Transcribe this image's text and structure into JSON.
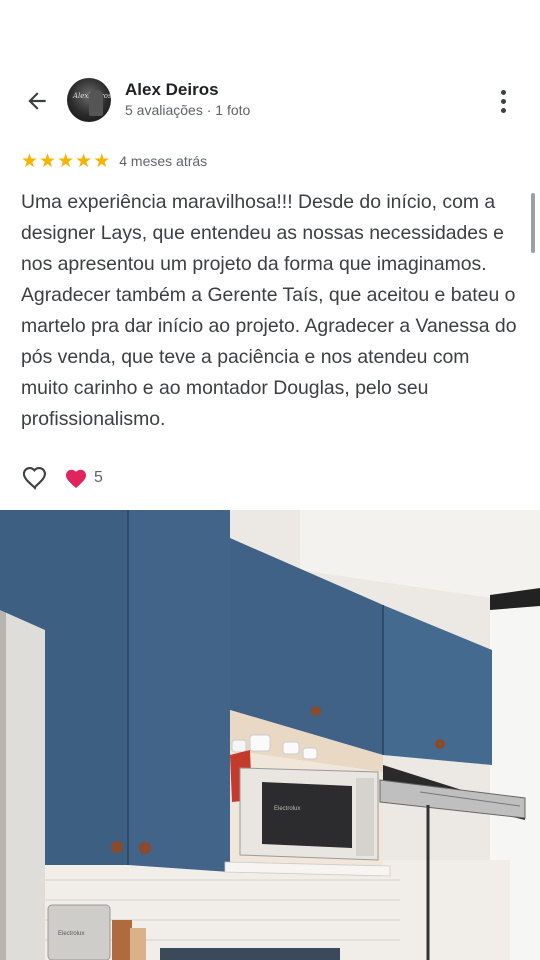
{
  "header": {
    "user_name": "Alex Deiros",
    "user_meta": "5 avaliações · 1 foto",
    "avatar_text": "AlexDeiros"
  },
  "review": {
    "rating": 5,
    "rating_max": 5,
    "date": "4 meses atrás",
    "text": "Uma experiência maravilhosa!!! Desde do início, com a designer Lays, que entendeu as nossas necessidades e nos apresentou um projeto da forma que imaginamos. Agradecer também a Gerente Taís, que aceitou e bateu o martelo pra dar início ao projeto. Agradecer a Vanessa do pós venda, que teve a paciência e nos atendeu com muito carinho e ao montador Douglas, pelo seu profissionalismo."
  },
  "reactions": {
    "like_icon": "heart-outline-icon",
    "reaction_icon": "red-heart-icon",
    "count": "5"
  },
  "photo": {
    "microwave_brand": "Electrolux",
    "appliance_brand": "Electrolux"
  },
  "colors": {
    "star": "#f5b400",
    "cabinet_blue": "#3d5f82",
    "heart_red": "#e0245e"
  }
}
